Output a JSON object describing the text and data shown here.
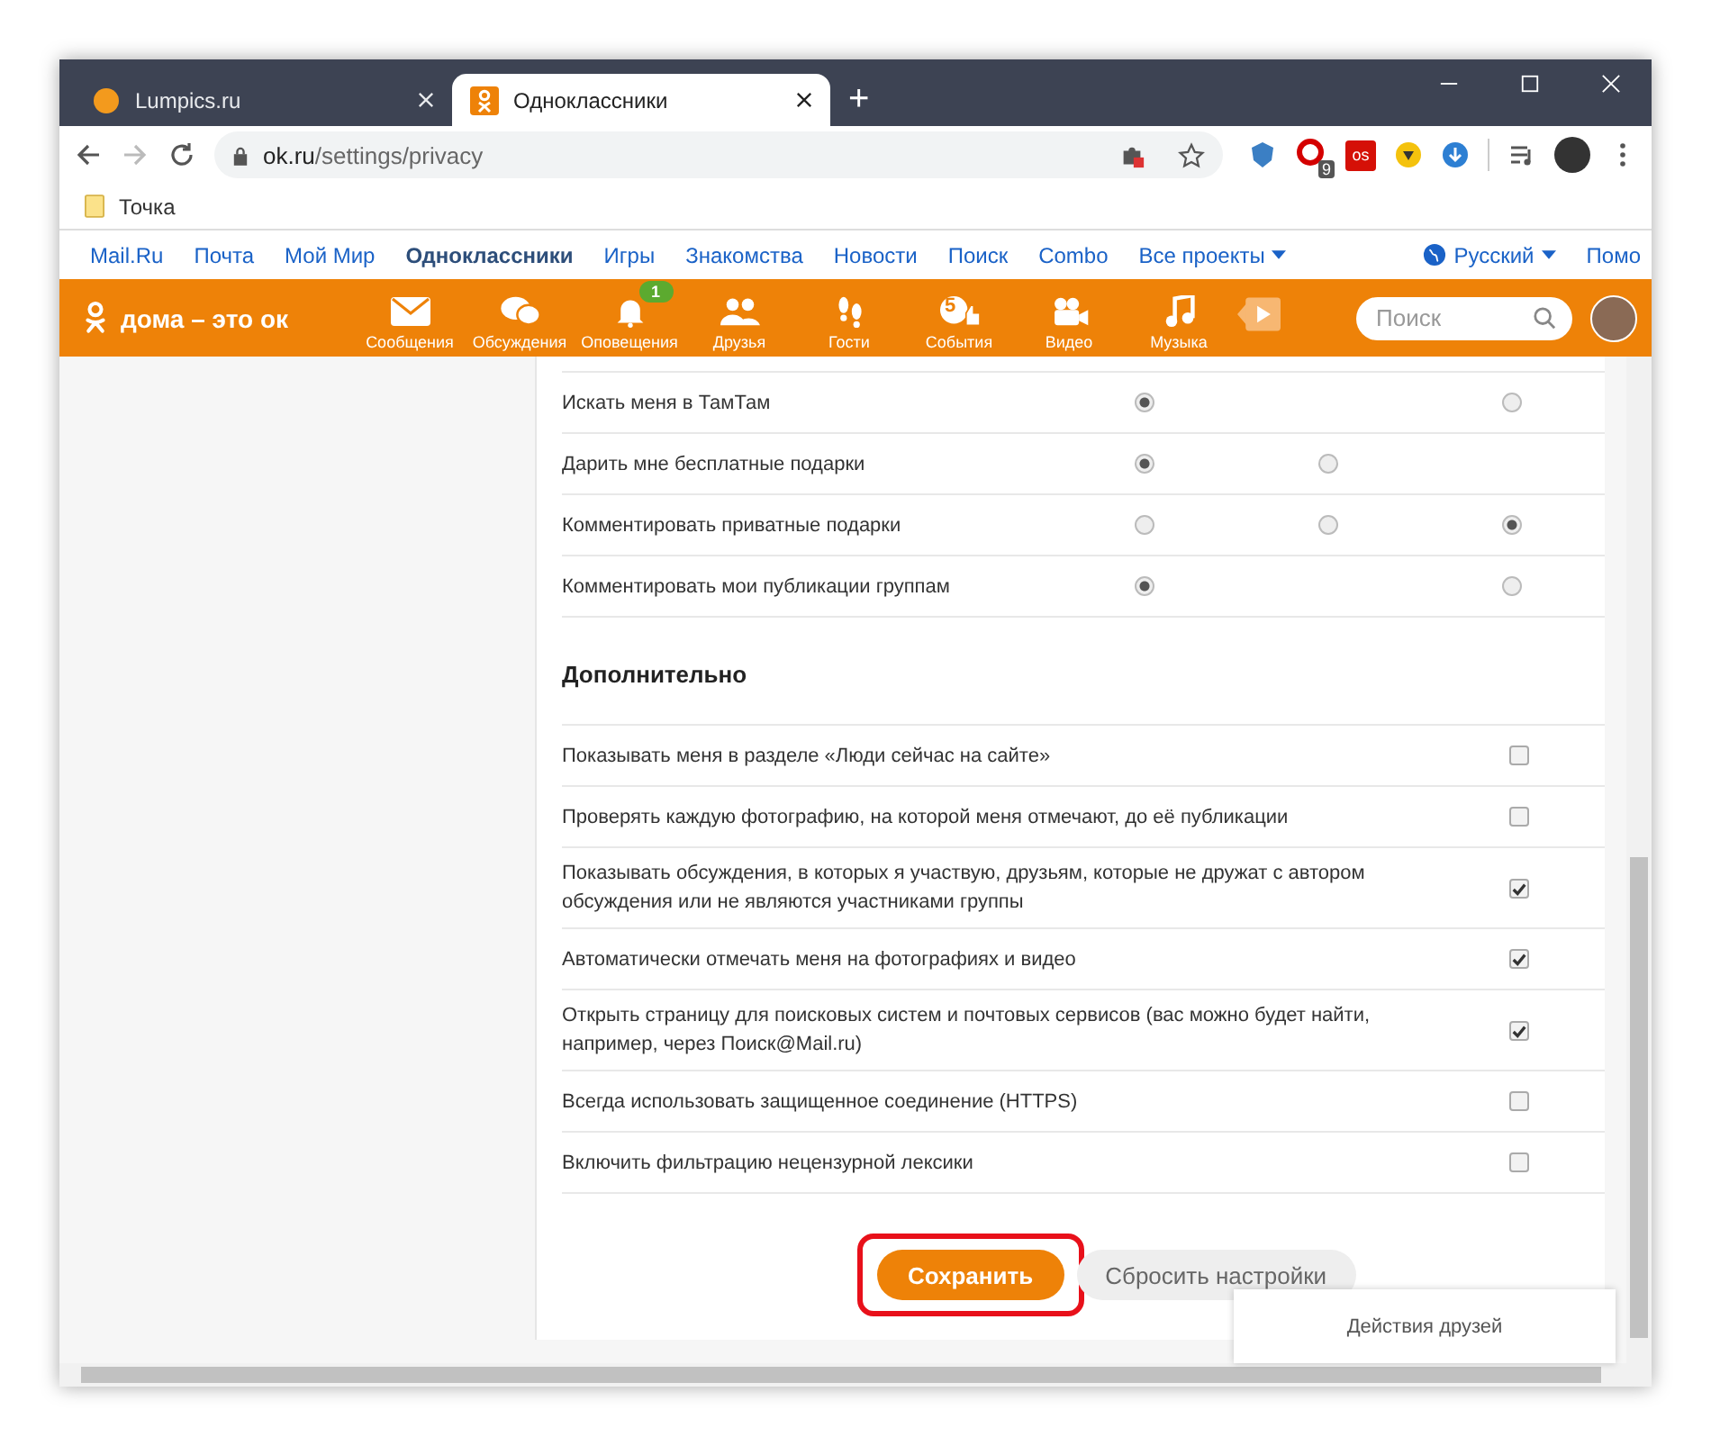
{
  "browser": {
    "tabs": [
      {
        "title": "Lumpics.ru",
        "selected": false
      },
      {
        "title": "Одноклассники",
        "selected": true
      }
    ],
    "new_tab": "+",
    "address": {
      "host": "ok.ru",
      "path": "/settings/privacy"
    },
    "extensions": [
      {
        "kind": "shield"
      },
      {
        "kind": "badge",
        "badge": "9"
      },
      {
        "kind": "text",
        "text": "os"
      },
      {
        "kind": "gem"
      },
      {
        "kind": "download"
      }
    ],
    "bookmarks": [
      "Точка"
    ]
  },
  "portal_bar": {
    "links": [
      {
        "label": "Mail.Ru",
        "selected": false
      },
      {
        "label": "Почта",
        "selected": false
      },
      {
        "label": "Мой Мир",
        "selected": false
      },
      {
        "label": "Одноклассники",
        "selected": true
      },
      {
        "label": "Игры",
        "selected": false
      },
      {
        "label": "Знакомства",
        "selected": false
      },
      {
        "label": "Новости",
        "selected": false
      },
      {
        "label": "Поиск",
        "selected": false
      },
      {
        "label": "Combo",
        "selected": false
      }
    ],
    "all_projects": "Все проекты",
    "language": "Русский",
    "help": "Помо"
  },
  "ok_header": {
    "logo_text": "дома – это ок",
    "nav": [
      {
        "kind": "mail",
        "label": "Сообщения"
      },
      {
        "kind": "chat",
        "label": "Обсуждения"
      },
      {
        "kind": "bell",
        "label": "Оповещения",
        "badge": "1"
      },
      {
        "kind": "people",
        "label": "Друзья"
      },
      {
        "kind": "feet",
        "label": "Гости"
      },
      {
        "kind": "events",
        "label": "События",
        "badge": "5"
      },
      {
        "kind": "camera",
        "label": "Видео"
      },
      {
        "kind": "music",
        "label": "Музыка"
      }
    ],
    "search": {
      "placeholder": "Поиск"
    }
  },
  "privacy_rows": [
    {
      "label": "Искать меня в ТамТам",
      "options": [
        {
          "kind": "radio",
          "selected": true
        },
        {
          "kind": "blank"
        },
        {
          "kind": "radio",
          "selected": false
        }
      ]
    },
    {
      "label": "Дарить мне бесплатные подарки",
      "options": [
        {
          "kind": "radio",
          "selected": true
        },
        {
          "kind": "radio",
          "selected": false
        },
        {
          "kind": "blank"
        }
      ]
    },
    {
      "label": "Комментировать приватные подарки",
      "options": [
        {
          "kind": "radio",
          "selected": false
        },
        {
          "kind": "radio",
          "selected": false
        },
        {
          "kind": "radio",
          "selected": true
        }
      ]
    },
    {
      "label": "Комментировать мои публикации группам",
      "options": [
        {
          "kind": "radio",
          "selected": true
        },
        {
          "kind": "blank"
        },
        {
          "kind": "radio",
          "selected": false
        }
      ]
    }
  ],
  "extra": {
    "title": "Дополнительно",
    "options": [
      {
        "label": "Показывать меня в разделе «Люди сейчас на сайте»",
        "checked": false
      },
      {
        "label": "Проверять каждую фотографию, на которой меня отмечают, до её публикации",
        "checked": false
      },
      {
        "label": "Показывать обсуждения, в которых я участвую, друзьям, которые не дружат с автором обсуждения или не являются участниками группы",
        "checked": true
      },
      {
        "label": "Автоматически отмечать меня на фотографиях и видео",
        "checked": true
      },
      {
        "label": "Открыть страницу для поисковых систем и почтовых сервисов (вас можно будет найти, например, через Поиск@Mail.ru)",
        "checked": true
      },
      {
        "label": "Всегда использовать защищенное соединение (HTTPS)",
        "checked": false
      },
      {
        "label": "Включить фильтрацию нецензурной лексики",
        "checked": false
      }
    ]
  },
  "buttons": {
    "save": "Сохранить",
    "reset": "Сбросить настройки",
    "save_highlighted": true
  },
  "friends_activity": "Действия друзей"
}
